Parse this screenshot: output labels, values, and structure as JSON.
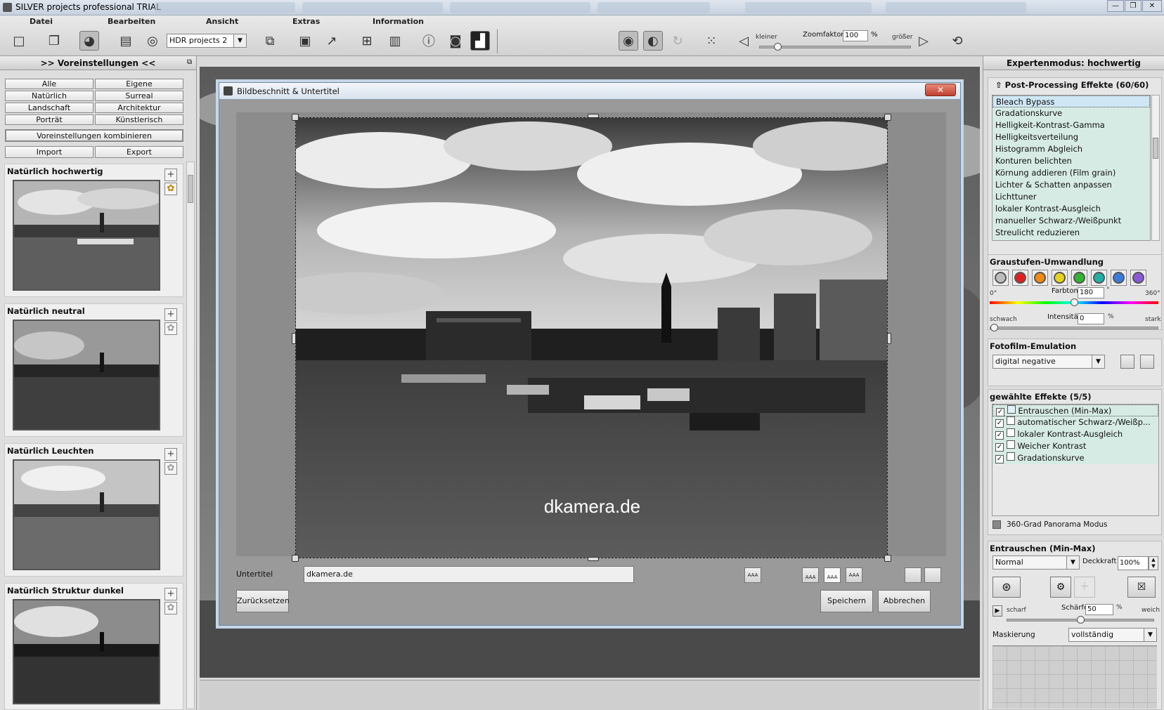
{
  "window": {
    "title": "SILVER projects professional  TRIAL",
    "controls": [
      "—",
      "❐",
      "✕"
    ]
  },
  "menu": {
    "labels": [
      "Datei",
      "Bearbeiten",
      "Ansicht",
      "Extras",
      "Information"
    ]
  },
  "toolbar": {
    "preset_combo": "HDR projects 2",
    "zoom_small": "kleiner",
    "zoom_label": "Zoomfaktor",
    "zoom_value": "100",
    "zoom_unit": "%",
    "zoom_large": "größer",
    "zoom_level": 0.1
  },
  "left": {
    "header": ">> Voreinstellungen <<",
    "filters": [
      "Alle",
      "Eigene",
      "Natürlich",
      "Surreal",
      "Landschaft",
      "Architektur",
      "Porträt",
      "Künstlerisch"
    ],
    "combine": "Voreinstellungen kombinieren",
    "import": "Import",
    "export": "Export",
    "presets": [
      "Natürlich hochwertig",
      "Natürlich neutral",
      "Natürlich Leuchten",
      "Natürlich Struktur dunkel"
    ]
  },
  "dialog": {
    "title": "Bildbeschnitt & Untertitel",
    "watermark": "dkamera.de",
    "subtitle_label": "Untertitel",
    "subtitle_value": "dkamera.de",
    "reset": "Zurücksetzen",
    "save": "Speichern",
    "cancel": "Abbrechen",
    "pos_icon_label": "AAA"
  },
  "right": {
    "header": "Expertenmodus: hochwertig",
    "pp_title": "Post-Processing Effekte (60/60)",
    "pp_items": [
      "Bleach Bypass",
      "Gradationskurve",
      "Helligkeit-Kontrast-Gamma",
      "Helligkeitsverteilung",
      "Histogramm Abgleich",
      "Konturen belichten",
      "Körnung addieren (Film grain)",
      "Lichter & Schatten anpassen",
      "Lichttuner",
      "lokaler Kontrast-Ausgleich",
      "manueller Schwarz-/Weißpunkt",
      "Streulicht reduzieren"
    ],
    "gray_title": "Graustufen-Umwandlung",
    "gray_colors": [
      "#bdbdbd",
      "#e02020",
      "#f08a10",
      "#e6d31a",
      "#2fb52f",
      "#1fb0a8",
      "#3a7be0",
      "#8a5ad8"
    ],
    "farbton_label": "Farbton",
    "farbton_value": "180",
    "farbton_unit": "°",
    "deg0": "0°",
    "deg360": "360°",
    "farbton_level": 0.5,
    "schwach": "schwach",
    "intens_label": "Intensität",
    "intens_value": "0",
    "intens_unit": "%",
    "stark": "stark",
    "intens_level": 0.0,
    "film_title": "Fotofilm-Emulation",
    "film_value": "digital negative",
    "chosen_title": "gewählte Effekte (5/5)",
    "chosen_items": [
      "Entrauschen (Min-Max)",
      "automatischer Schwarz-/Weißp...",
      "lokaler Kontrast-Ausgleich",
      "Weicher Kontrast",
      "Gradationskurve"
    ],
    "panorama": "360-Grad Panorama Modus",
    "ent_title": "Entrauschen (Min-Max)",
    "blend_value": "Normal",
    "deckkraft_label": "Deckkraft",
    "deckkraft_value": "100%",
    "scharf": "scharf",
    "schaerfe_label": "Schärfe",
    "schaerfe_value": "50",
    "schaerfe_unit": "%",
    "weich": "weich",
    "schaerfe_level": 0.5,
    "mask_label": "Maskierung",
    "mask_value": "vollständig"
  }
}
